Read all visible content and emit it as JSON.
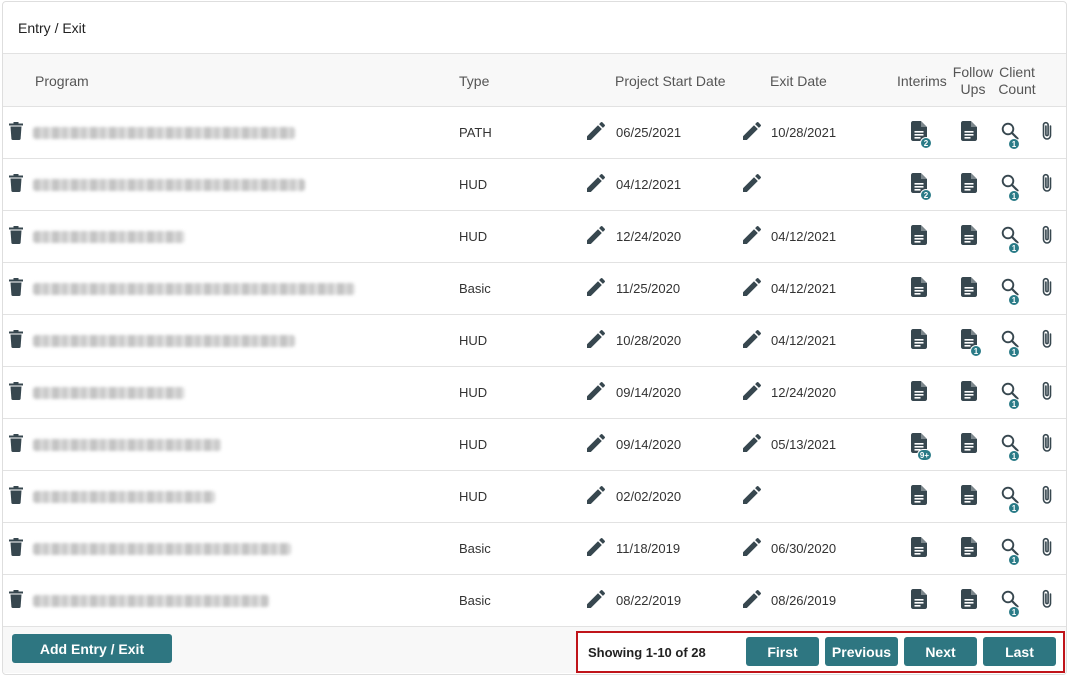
{
  "card": {
    "title": "Entry / Exit"
  },
  "columns": {
    "program": "Program",
    "type": "Type",
    "start": "Project Start Date",
    "exit": "Exit Date",
    "interims": "Interims",
    "followups_1": "Follow",
    "followups_2": "Ups",
    "client_1": "Client",
    "client_2": "Count"
  },
  "rows": [
    {
      "type": "PATH",
      "start": "06/25/2021",
      "exit": "10/28/2021",
      "interims_badge": "2",
      "followups_badge": "",
      "client_count": "1"
    },
    {
      "type": "HUD",
      "start": "04/12/2021",
      "exit": "",
      "interims_badge": "2",
      "followups_badge": "",
      "client_count": "1"
    },
    {
      "type": "HUD",
      "start": "12/24/2020",
      "exit": "04/12/2021",
      "interims_badge": "",
      "followups_badge": "",
      "client_count": "1"
    },
    {
      "type": "Basic",
      "start": "11/25/2020",
      "exit": "04/12/2021",
      "interims_badge": "",
      "followups_badge": "",
      "client_count": "1"
    },
    {
      "type": "HUD",
      "start": "10/28/2020",
      "exit": "04/12/2021",
      "interims_badge": "",
      "followups_badge": "1",
      "client_count": "1"
    },
    {
      "type": "HUD",
      "start": "09/14/2020",
      "exit": "12/24/2020",
      "interims_badge": "",
      "followups_badge": "",
      "client_count": "1"
    },
    {
      "type": "HUD",
      "start": "09/14/2020",
      "exit": "05/13/2021",
      "interims_badge": "9+",
      "followups_badge": "",
      "client_count": "1"
    },
    {
      "type": "HUD",
      "start": "02/02/2020",
      "exit": "",
      "interims_badge": "",
      "followups_badge": "",
      "client_count": "1"
    },
    {
      "type": "Basic",
      "start": "11/18/2019",
      "exit": "06/30/2020",
      "interims_badge": "",
      "followups_badge": "",
      "client_count": "1"
    },
    {
      "type": "Basic",
      "start": "08/22/2019",
      "exit": "08/26/2019",
      "interims_badge": "",
      "followups_badge": "",
      "client_count": "1"
    }
  ],
  "footer": {
    "add_label": "Add Entry / Exit",
    "showing": "Showing 1-10 of 28",
    "first": "First",
    "previous": "Previous",
    "next": "Next",
    "last": "Last"
  },
  "icons": {
    "trash": "trash-icon",
    "edit": "pencil-icon",
    "document": "document-icon",
    "client": "magnifier-icon",
    "attach": "paperclip-icon"
  },
  "colors": {
    "accent": "#2e7681",
    "badge": "#2a7b87",
    "icon": "#37474f",
    "highlight": "#c0141a"
  }
}
